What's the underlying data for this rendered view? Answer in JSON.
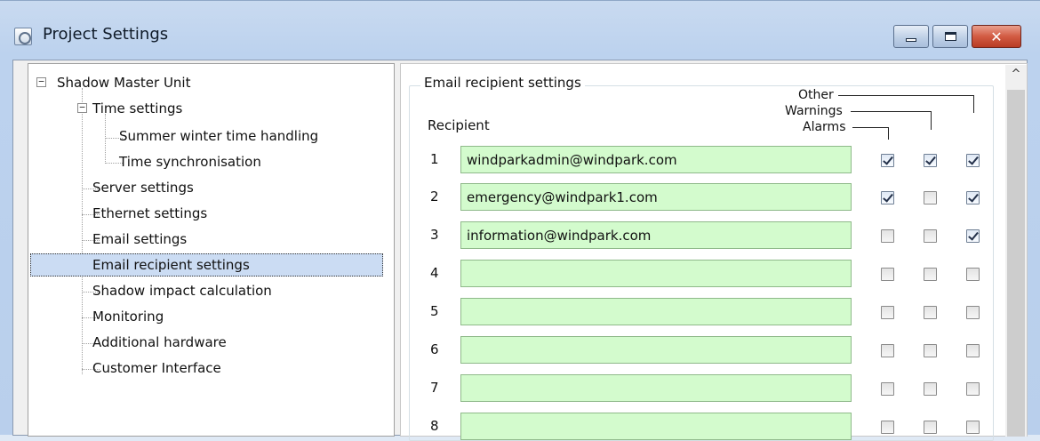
{
  "window": {
    "title": "Project Settings",
    "minimize_icon": "minimize-icon",
    "maximize_icon": "maximize-icon",
    "close_icon": "close-icon",
    "close_glyph": "✕"
  },
  "tree": {
    "root": {
      "label": "Shadow Master Unit",
      "expander": "−"
    },
    "time": {
      "label": "Time settings",
      "expander": "−"
    },
    "summer": {
      "label": "Summer winter time handling"
    },
    "sync": {
      "label": "Time synchronisation"
    },
    "server": {
      "label": "Server settings"
    },
    "ethernet": {
      "label": "Ethernet settings"
    },
    "email": {
      "label": "Email settings"
    },
    "recipient": {
      "label": "Email recipient settings"
    },
    "shadow": {
      "label": "Shadow impact calculation"
    },
    "monitoring": {
      "label": "Monitoring"
    },
    "hardware": {
      "label": "Additional hardware"
    },
    "customer": {
      "label": "Customer Interface"
    }
  },
  "panel": {
    "group_title": "Email recipient settings",
    "recipient_label": "Recipient",
    "headers": {
      "other": "Other",
      "warnings": "Warnings",
      "alarms": "Alarms"
    },
    "scroll_up_glyph": "^",
    "rows": [
      {
        "num": "1",
        "email": "windparkadmin@windpark.com",
        "alarms": true,
        "warnings": true,
        "other": true
      },
      {
        "num": "2",
        "email": "emergency@windpark1.com",
        "alarms": true,
        "warnings": false,
        "other": true
      },
      {
        "num": "3",
        "email": "information@windpark.com",
        "alarms": false,
        "warnings": false,
        "other": true
      },
      {
        "num": "4",
        "email": "",
        "alarms": false,
        "warnings": false,
        "other": false
      },
      {
        "num": "5",
        "email": "",
        "alarms": false,
        "warnings": false,
        "other": false
      },
      {
        "num": "6",
        "email": "",
        "alarms": false,
        "warnings": false,
        "other": false
      },
      {
        "num": "7",
        "email": "",
        "alarms": false,
        "warnings": false,
        "other": false
      },
      {
        "num": "8",
        "email": "",
        "alarms": false,
        "warnings": false,
        "other": false
      }
    ]
  }
}
